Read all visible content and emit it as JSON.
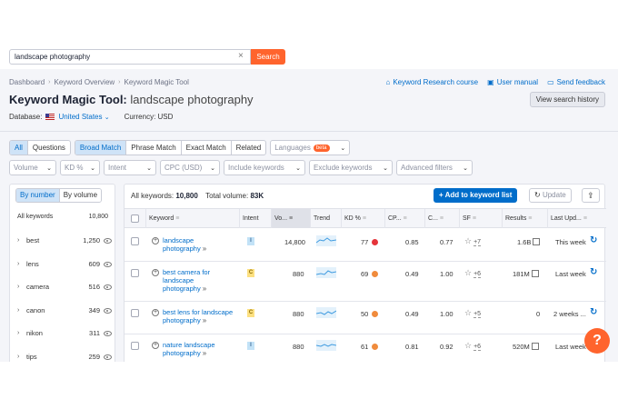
{
  "search": {
    "value": "landscape photography",
    "clear": "×",
    "button": "Search"
  },
  "breadcrumb": [
    "Dashboard",
    "Keyword Overview",
    "Keyword Magic Tool"
  ],
  "top_links": {
    "course": "Keyword Research course",
    "manual": "User manual",
    "feedback": "Send feedback"
  },
  "title": {
    "tool": "Keyword Magic Tool:",
    "keyword": "landscape photography"
  },
  "view_history": "View search history",
  "database": {
    "label": "Database:",
    "value": "United States",
    "currency": "Currency: USD"
  },
  "question_tabs": [
    "All",
    "Questions"
  ],
  "match_tabs": [
    "Broad Match",
    "Phrase Match",
    "Exact Match",
    "Related"
  ],
  "languages": {
    "label": "Languages",
    "badge": "beta"
  },
  "filters": [
    "Volume",
    "KD %",
    "Intent",
    "CPC (USD)",
    "Include keywords",
    "Exclude keywords",
    "Advanced filters"
  ],
  "groups": {
    "tabs": [
      "By number",
      "By volume"
    ],
    "header": {
      "label": "All keywords",
      "count": "10,800"
    },
    "items": [
      {
        "name": "best",
        "count": "1,250"
      },
      {
        "name": "lens",
        "count": "609"
      },
      {
        "name": "camera",
        "count": "516"
      },
      {
        "name": "canon",
        "count": "349"
      },
      {
        "name": "nikon",
        "count": "311"
      },
      {
        "name": "tips",
        "count": "259"
      }
    ]
  },
  "summary": {
    "all_label": "All keywords:",
    "all_value": "10,800",
    "vol_label": "Total volume:",
    "vol_value": "83K"
  },
  "actions": {
    "add": "Add to keyword list",
    "update": "Update"
  },
  "columns": [
    "Keyword",
    "Intent",
    "Vo...",
    "Trend",
    "KD %",
    "CP...",
    "C...",
    "SF",
    "Results",
    "Last Upd..."
  ],
  "rows": [
    {
      "kw1": "landscape",
      "kw2": "photography",
      "kw3": "",
      "intent": "I",
      "volume": "14,800",
      "kd": "77",
      "kd_color": "#e5343a",
      "cpc": "0.85",
      "com": "0.77",
      "sf": "+7",
      "results": "1.6B",
      "updated": "This week"
    },
    {
      "kw1": "best camera for",
      "kw2": "landscape",
      "kw3": "photography",
      "intent": "C",
      "volume": "880",
      "kd": "69",
      "kd_color": "#f08b3c",
      "cpc": "0.49",
      "com": "1.00",
      "sf": "+6",
      "results": "181M",
      "updated": "Last week"
    },
    {
      "kw1": "best lens for landscape",
      "kw2": "photography",
      "kw3": "",
      "intent": "C",
      "volume": "880",
      "kd": "50",
      "kd_color": "#f08b3c",
      "cpc": "0.49",
      "com": "1.00",
      "sf": "+5",
      "results": "0",
      "updated": "2 weeks ..."
    },
    {
      "kw1": "nature landscape",
      "kw2": "photography",
      "kw3": "",
      "intent": "I",
      "volume": "880",
      "kd": "61",
      "kd_color": "#f08b3c",
      "cpc": "0.81",
      "com": "0.92",
      "sf": "+6",
      "results": "520M",
      "updated": "Last week"
    }
  ],
  "help": "?",
  "colors": {
    "accent": "#ff642d",
    "link": "#006dca"
  }
}
